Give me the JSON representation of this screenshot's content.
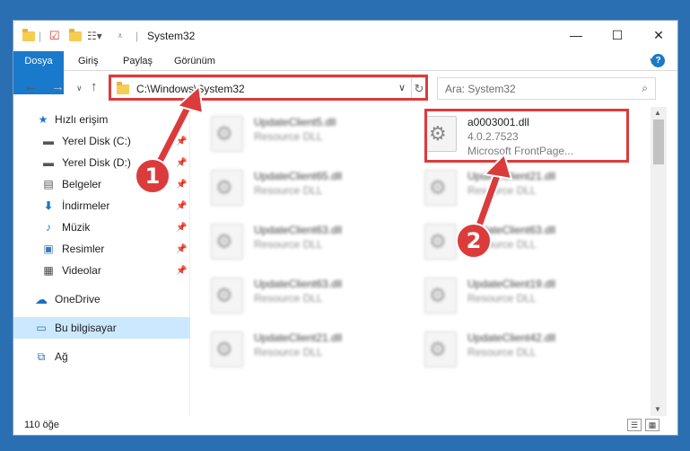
{
  "window": {
    "title": "System32",
    "controls": {
      "minimize": "—",
      "maximize": "☐",
      "close": "✕"
    }
  },
  "ribbon": {
    "tabs": [
      "Dosya",
      "Giriş",
      "Paylaş",
      "Görünüm"
    ],
    "expand": "∨",
    "help": "?"
  },
  "address": {
    "path": "C:\\Windows\\System32",
    "search_placeholder": "Ara: System32"
  },
  "nav": {
    "items": [
      {
        "label": "Hızlı erişim",
        "icon": "star-icon",
        "pinned": false
      },
      {
        "label": "Yerel Disk (C:)",
        "icon": "drive-icon",
        "pinned": true
      },
      {
        "label": "Yerel Disk (D:)",
        "icon": "drive-icon",
        "pinned": true
      },
      {
        "label": "Belgeler",
        "icon": "documents-icon",
        "pinned": true
      },
      {
        "label": "İndirmeler",
        "icon": "download-icon",
        "pinned": true
      },
      {
        "label": "Müzik",
        "icon": "music-icon",
        "pinned": true
      },
      {
        "label": "Resimler",
        "icon": "pictures-icon",
        "pinned": true
      },
      {
        "label": "Videolar",
        "icon": "videos-icon",
        "pinned": true
      },
      {
        "label": "OneDrive",
        "icon": "cloud-icon",
        "pinned": false
      },
      {
        "label": "Bu bilgisayar",
        "icon": "computer-icon",
        "pinned": false,
        "selected": true
      },
      {
        "label": "Ağ",
        "icon": "network-icon",
        "pinned": false
      }
    ]
  },
  "files": {
    "left": [
      {
        "name": "UpdateClient5.dll",
        "type": "Resource DLL"
      },
      {
        "name": "UpdateClient65.dll",
        "type": "Resource DLL"
      },
      {
        "name": "UpdateClient63.dll",
        "type": "Resource DLL"
      },
      {
        "name": "UpdateClient63.dll",
        "type": "Resource DLL"
      },
      {
        "name": "UpdateClient21.dll",
        "type": "Resource DLL"
      }
    ],
    "right": [
      {
        "name": "a0003001.dll",
        "version": "4.0.2.7523",
        "type": "Microsoft FrontPage..."
      },
      {
        "name": "UpdateClient21.dll",
        "type": "Resource DLL"
      },
      {
        "name": "UpdateClient63.dll",
        "type": "Resource DLL"
      },
      {
        "name": "UpdateClient19.dll",
        "type": "Resource DLL"
      },
      {
        "name": "UpdateClient42.dll",
        "type": "Resource DLL"
      }
    ]
  },
  "status": {
    "count": "110 öğe"
  },
  "callouts": {
    "one": "1",
    "two": "2"
  },
  "colors": {
    "accent": "#1979ca",
    "highlight": "#dc3b3b",
    "desktop": "#2a6fb2"
  }
}
